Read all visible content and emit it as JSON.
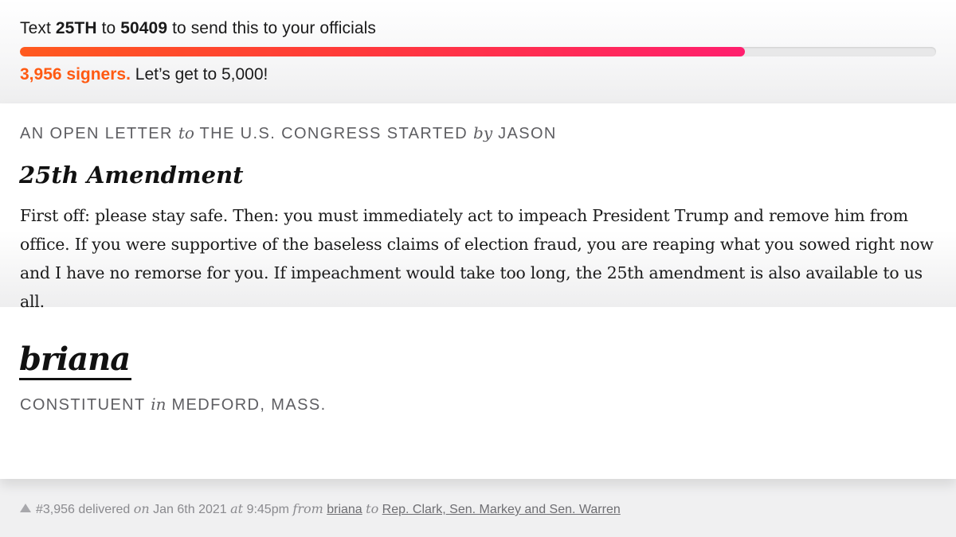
{
  "sms": {
    "prefix": "Text",
    "keyword": "25TH",
    "middle": "to",
    "number": "50409",
    "suffix": "to send this to your officials"
  },
  "progress": {
    "signers": 3956,
    "goal": 5000,
    "fraction": 0.7913,
    "signers_label": "3,956 signers.",
    "goal_label": "Let’s get to 5,000!",
    "gradient_start": "#ff5a1f",
    "gradient_end": "#ff1f6e"
  },
  "letter": {
    "header": {
      "part1": "An open letter",
      "to": "to",
      "part2": "the U.S. Congress started",
      "by": "by",
      "author": "Jason"
    },
    "title": "25th Amendment",
    "body": "First off: please stay safe. Then: you must immediately act to impeach President Trump and remove him from office. If you were supportive of the baseless claims of election fraud, you are reaping what you sowed right now and I have no remorse for you. If impeachment would take too long, the 25th amendment is also available to us all.",
    "signature": "briana",
    "constituent": {
      "prefix": "Constituent",
      "in": "in",
      "location": "Medford, Mass."
    }
  },
  "footer": {
    "number": "#3,956 delivered",
    "on": "on",
    "date": "Jan 6th 2021",
    "at": "at",
    "time": "9:45pm",
    "from": "from",
    "sender": "briana",
    "to": "to",
    "recipients": "Rep. Clark, Sen. Markey and Sen. Warren"
  }
}
